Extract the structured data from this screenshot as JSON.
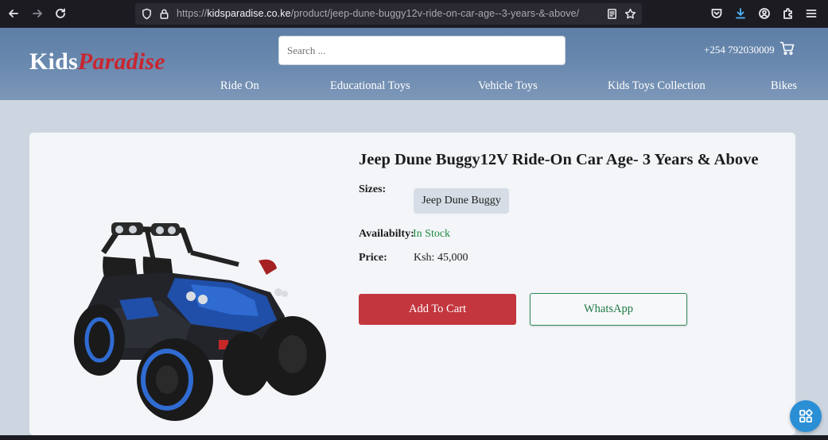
{
  "browser": {
    "url_scheme": "https://",
    "url_host": "kidsparadise.co.ke",
    "url_path": "/product/jeep-dune-buggy12v-ride-on-car-age--3-years-&-above/"
  },
  "header": {
    "logo_part1": "Kids",
    "logo_part2": "Paradise",
    "search_placeholder": "Search ...",
    "phone": "+254 792030009",
    "nav": [
      "Ride On",
      "Educational Toys",
      "Vehicle Toys",
      "Kids Toys Collection",
      "Bikes"
    ]
  },
  "product": {
    "title": "Jeep Dune Buggy12V Ride-On Car Age- 3 Years & Above",
    "sizes_label": "Sizes:",
    "size_option": "Jeep Dune Buggy",
    "availability_label": "Availabilty:",
    "availability_value": "In Stock",
    "price_label": "Price:",
    "price_value": "Ksh: 45,000",
    "add_to_cart_label": "Add To Cart",
    "whatsapp_label": "WhatsApp"
  },
  "colors": {
    "accent_red": "#c3363e",
    "whatsapp_green": "#2e8b57",
    "stock_green": "#1d8a3f",
    "header_blue": "#6b8ab0"
  },
  "icons": [
    "back-icon",
    "forward-icon",
    "reload-icon",
    "shield-icon",
    "lock-icon",
    "reader-view-icon",
    "bookmark-star-icon",
    "pocket-icon",
    "download-icon",
    "account-icon",
    "extensions-icon",
    "menu-icon",
    "cart-icon",
    "grid-widget-icon"
  ]
}
